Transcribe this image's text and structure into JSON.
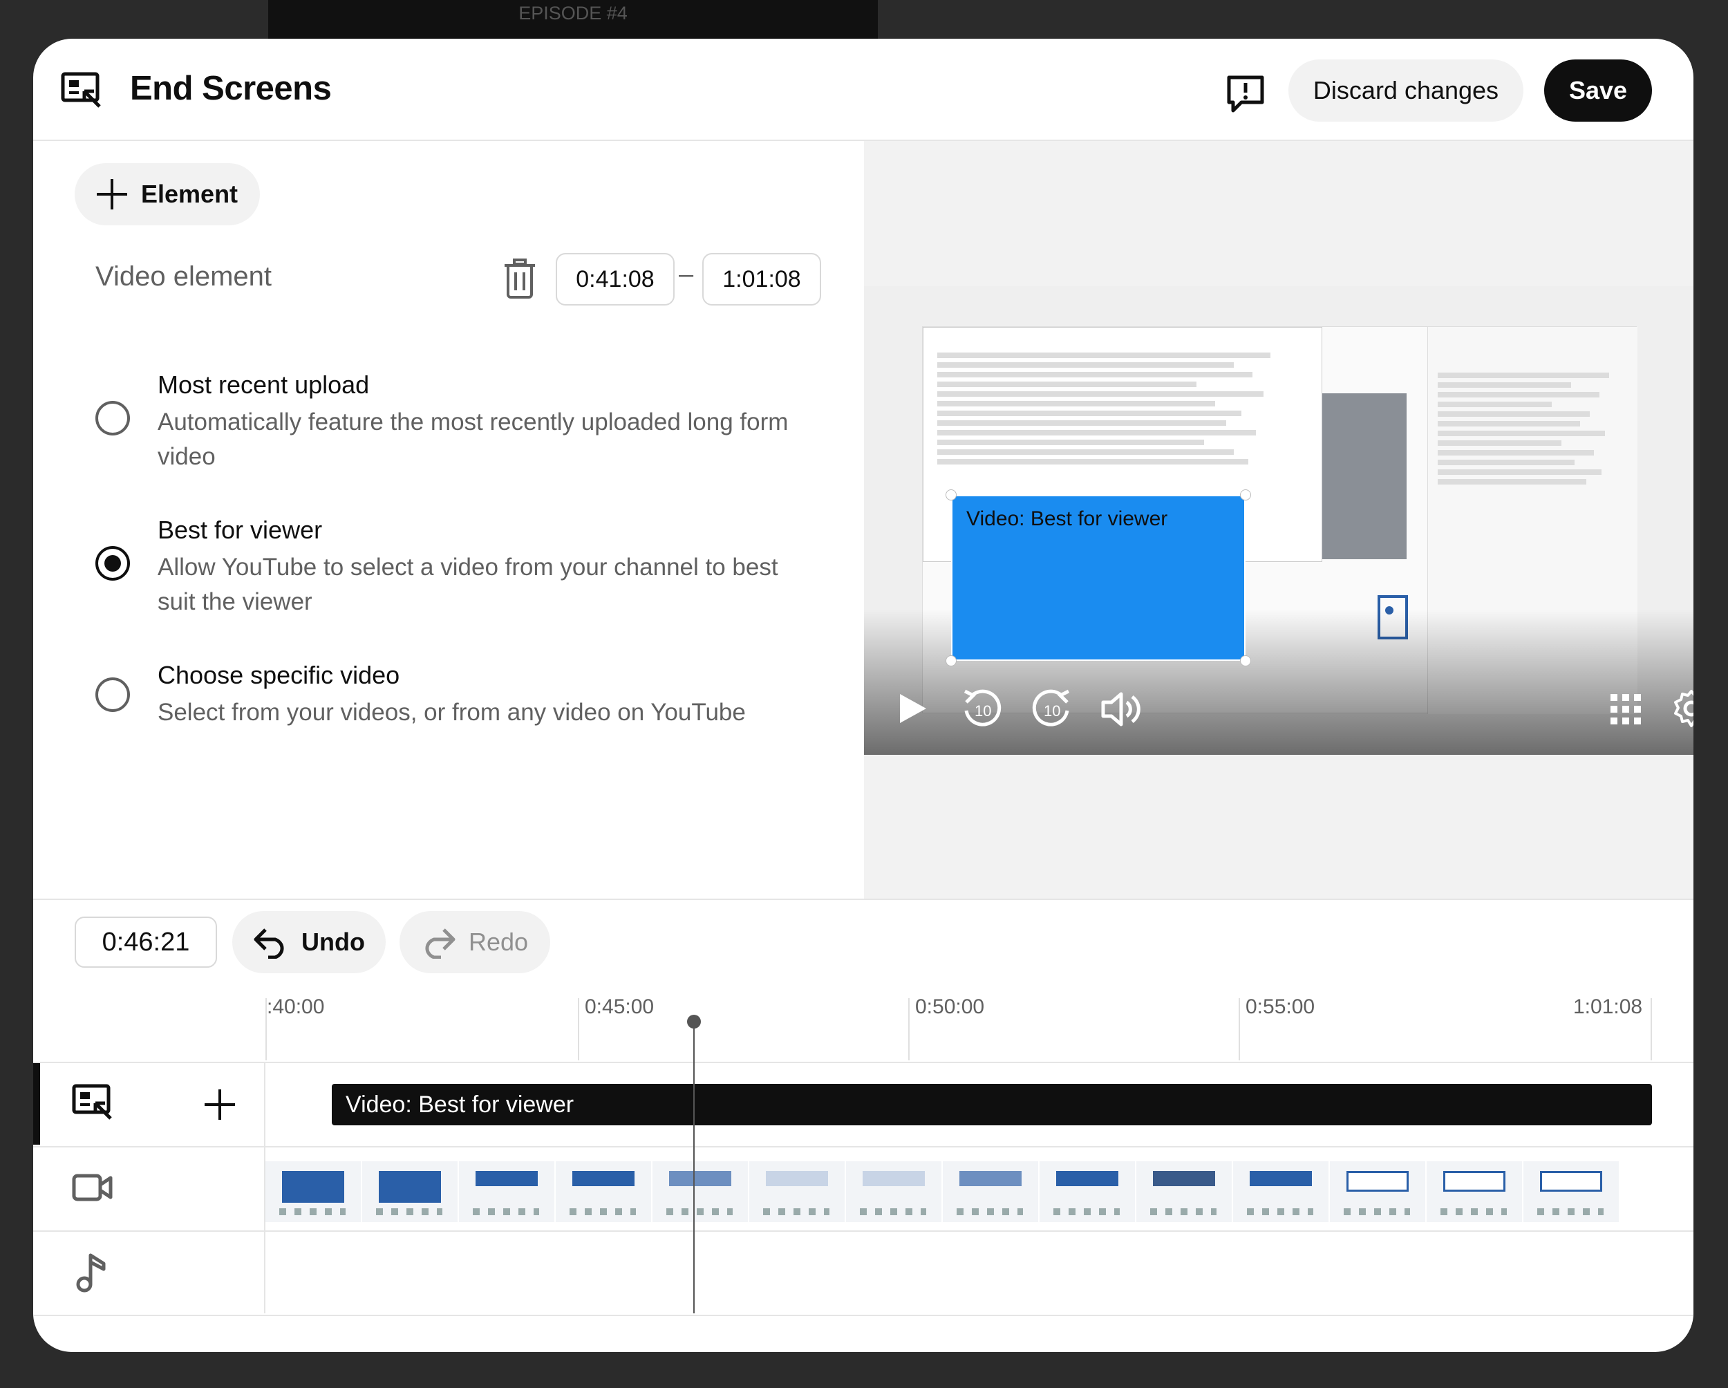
{
  "background_text": "EPISODE #4",
  "header": {
    "title": "End Screens",
    "discard_label": "Discard changes",
    "save_label": "Save"
  },
  "editor": {
    "add_element_label": "Element",
    "element_type_label": "Video element",
    "start_time": "0:41:08",
    "end_time": "1:01:08",
    "dash": "–",
    "options": [
      {
        "title": "Most recent upload",
        "description": "Automatically feature the most recently uploaded long form video",
        "selected": false
      },
      {
        "title": "Best for viewer",
        "description": "Allow YouTube to select a video from your channel to best suit the viewer",
        "selected": true
      },
      {
        "title": "Choose specific video",
        "description": "Select from your videos, or from any video on YouTube",
        "selected": false
      }
    ]
  },
  "preview": {
    "end_screen_label": "Video: Best for viewer"
  },
  "timeline": {
    "current_time": "0:46:21",
    "undo_label": "Undo",
    "redo_label": "Redo",
    "ruler": [
      ":40:00",
      "0:45:00",
      "0:50:00",
      "0:55:00",
      "1:01:08"
    ],
    "end_screen_track_label": "Video: Best for viewer"
  },
  "colors": {
    "accent_blue": "#1a8cf0",
    "dark": "#0f0f0f"
  }
}
